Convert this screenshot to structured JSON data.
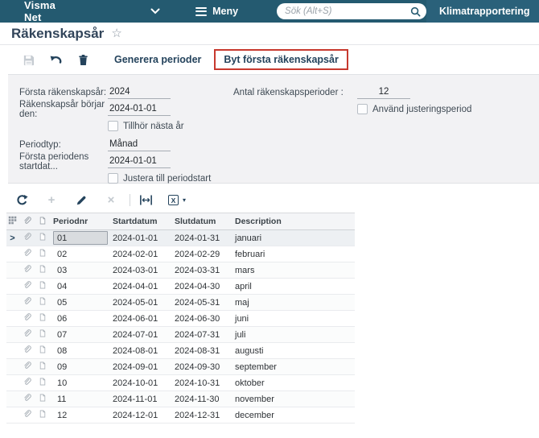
{
  "topbar": {
    "brand": "Visma Net",
    "menu_label": "Meny",
    "search_placeholder": "Sök (Alt+S)",
    "company": "Klimatrapportering"
  },
  "page": {
    "title": "Räkenskapsår"
  },
  "toolbar": {
    "generate_periods_label": "Generera perioder",
    "change_first_year_label": "Byt första räkenskapsår"
  },
  "form": {
    "first_fiscal_year": {
      "label": "Första räkenskapsår:",
      "value": "2024"
    },
    "fiscal_year_starts": {
      "label": "Räkenskapsår börjar den:",
      "value": "2024-01-01"
    },
    "belongs_next_year": {
      "label": "Tillhör nästa år",
      "checked": false
    },
    "period_type": {
      "label": "Periodtyp:",
      "value": "Månad"
    },
    "first_period_start": {
      "label": "Första periodens startdat...",
      "value": "2024-01-01"
    },
    "adjust_to_period_start": {
      "label": "Justera till periodstart",
      "checked": false
    },
    "number_of_periods": {
      "label": "Antal räkenskapsperioder :",
      "value": "12"
    },
    "use_adjustment_period": {
      "label": "Använd justeringsperiod",
      "checked": false
    }
  },
  "grid": {
    "columns": [
      "Periodnr",
      "Startdatum",
      "Slutdatum",
      "Description"
    ],
    "selected_row": 0,
    "rows": [
      {
        "periodnr": "01",
        "start": "2024-01-01",
        "end": "2024-01-31",
        "desc": "januari"
      },
      {
        "periodnr": "02",
        "start": "2024-02-01",
        "end": "2024-02-29",
        "desc": "februari"
      },
      {
        "periodnr": "03",
        "start": "2024-03-01",
        "end": "2024-03-31",
        "desc": "mars"
      },
      {
        "periodnr": "04",
        "start": "2024-04-01",
        "end": "2024-04-30",
        "desc": "april"
      },
      {
        "periodnr": "05",
        "start": "2024-05-01",
        "end": "2024-05-31",
        "desc": "maj"
      },
      {
        "periodnr": "06",
        "start": "2024-06-01",
        "end": "2024-06-30",
        "desc": "juni"
      },
      {
        "periodnr": "07",
        "start": "2024-07-01",
        "end": "2024-07-31",
        "desc": "juli"
      },
      {
        "periodnr": "08",
        "start": "2024-08-01",
        "end": "2024-08-31",
        "desc": "augusti"
      },
      {
        "periodnr": "09",
        "start": "2024-09-01",
        "end": "2024-09-30",
        "desc": "september"
      },
      {
        "periodnr": "10",
        "start": "2024-10-01",
        "end": "2024-10-31",
        "desc": "oktober"
      },
      {
        "periodnr": "11",
        "start": "2024-11-01",
        "end": "2024-11-30",
        "desc": "november"
      },
      {
        "periodnr": "12",
        "start": "2024-12-01",
        "end": "2024-12-31",
        "desc": "december"
      }
    ]
  },
  "icons": {
    "favorite_star": "☆",
    "chevron_small": "▾",
    "plus": "+",
    "close_x": "×",
    "excel_letter": "X",
    "row_pointer": ">"
  },
  "colors": {
    "topbar": "#245a70",
    "highlight_red": "#c7392e",
    "panel_bg": "#f2f2f4",
    "toolbar_icon": "#24435c"
  }
}
